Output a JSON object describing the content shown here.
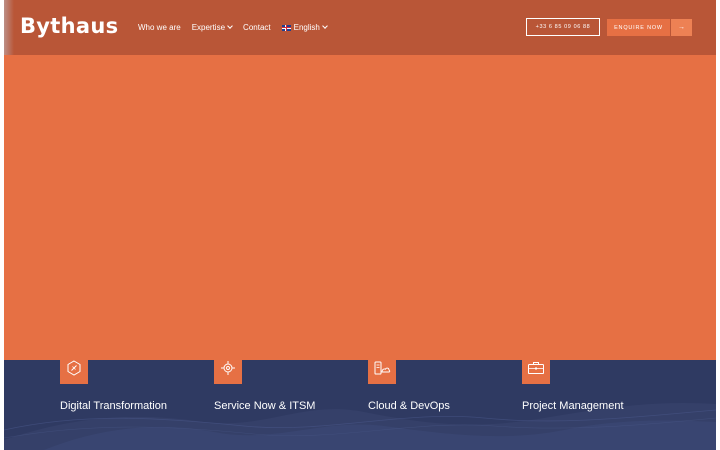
{
  "header": {
    "logo": "Bythaus",
    "nav": [
      {
        "label": "Who we are"
      },
      {
        "label": "Expertise"
      },
      {
        "label": "Contact"
      },
      {
        "label": "English"
      }
    ],
    "phone": "+33 6 85 09 06 88",
    "enquire": "ENQUIRE NOW",
    "arrow": "→"
  },
  "services": [
    {
      "title": "Digital Transformation",
      "icon": "compass-icon"
    },
    {
      "title": "Service Now & ITSM",
      "icon": "settings-gear-icon"
    },
    {
      "title": "Cloud & DevOps",
      "icon": "devices-cloud-icon"
    },
    {
      "title": "Project Management",
      "icon": "briefcase-icon"
    }
  ],
  "colors": {
    "accent": "#e67044",
    "header": "#b95637",
    "services_bg": "#2f3a62"
  }
}
